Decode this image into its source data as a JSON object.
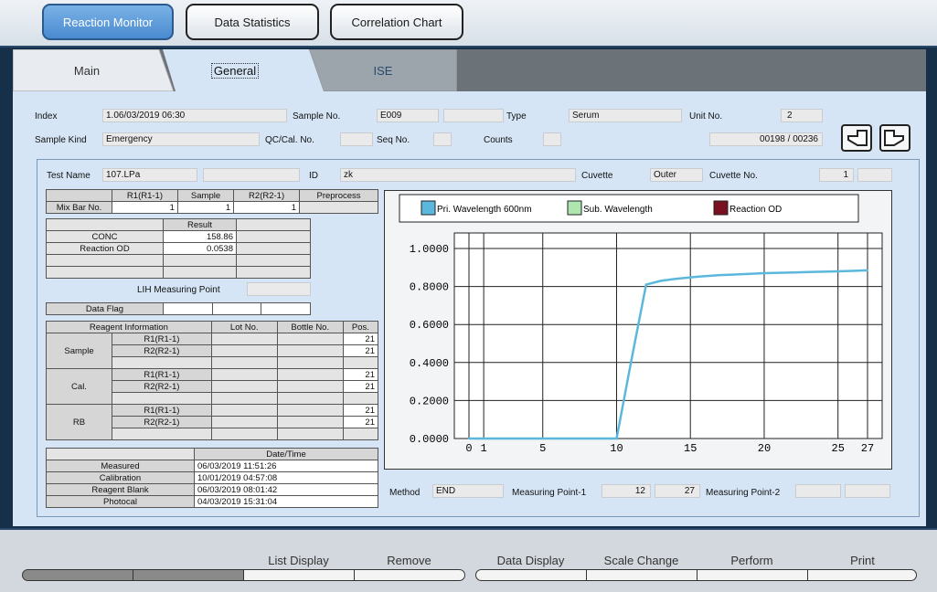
{
  "top_buttons": [
    "Reaction Monitor",
    "Data Statistics",
    "Correlation Chart"
  ],
  "tabs": [
    "Main",
    "General",
    "ISE"
  ],
  "header": {
    "index_label": "Index",
    "index_value": "1.06/03/2019 06:30",
    "sample_no_label": "Sample No.",
    "sample_no_value": "E009",
    "type_label": "Type",
    "type_value": "Serum",
    "unit_no_label": "Unit No.",
    "unit_no_value": "2",
    "sample_kind_label": "Sample Kind",
    "sample_kind_value": "Emergency",
    "qc_label": "QC/Cal. No.",
    "seq_label": "Seq No.",
    "counts_label": "Counts",
    "page_counter": "00198 / 00236"
  },
  "test": {
    "test_name_label": "Test Name",
    "test_name_value": "107.LPa",
    "id_label": "ID",
    "id_value": "zk",
    "cuvette_label": "Cuvette",
    "cuvette_value": "Outer",
    "cuvette_no_label": "Cuvette No.",
    "cuvette_no_value": "1"
  },
  "mix_table": {
    "headers": [
      "R1(R1-1)",
      "Sample",
      "R2(R2-1)",
      "Preprocess"
    ],
    "row_label": "Mix Bar No.",
    "values": [
      "1",
      "1",
      "1",
      ""
    ]
  },
  "result_table": {
    "header": "Result",
    "rows": [
      {
        "label": "CONC",
        "value": "158.86"
      },
      {
        "label": "Reaction OD",
        "value": "0.0538"
      }
    ]
  },
  "lih_label": "LIH Measuring Point",
  "data_flag_label": "Data Flag",
  "reagent_table": {
    "headers": [
      "Reagent Information",
      "Lot No.",
      "Bottle No.",
      "Pos."
    ],
    "groups": [
      {
        "name": "Sample",
        "rows": [
          {
            "reagent": "R1(R1-1)",
            "pos": "21"
          },
          {
            "reagent": "R2(R2-1)",
            "pos": "21"
          }
        ]
      },
      {
        "name": "Cal.",
        "rows": [
          {
            "reagent": "R1(R1-1)",
            "pos": "21"
          },
          {
            "reagent": "R2(R2-1)",
            "pos": "21"
          }
        ]
      },
      {
        "name": "RB",
        "rows": [
          {
            "reagent": "R1(R1-1)",
            "pos": "21"
          },
          {
            "reagent": "R2(R2-1)",
            "pos": "21"
          }
        ]
      }
    ]
  },
  "datetime_table": {
    "header": "Date/Time",
    "rows": [
      {
        "label": "Measured",
        "value": "06/03/2019 11:51:26"
      },
      {
        "label": "Calibration",
        "value": "10/01/2019 04:57:08"
      },
      {
        "label": "Reagent Blank",
        "value": "06/03/2019 08:01:42"
      },
      {
        "label": "Photocal",
        "value": "04/03/2019 15:31:04"
      }
    ]
  },
  "chart_data": {
    "type": "line",
    "x_ticks": [
      "0",
      "1",
      "5",
      "10",
      "15",
      "20",
      "25",
      "27"
    ],
    "y_ticks": [
      "0.0000",
      "0.2000",
      "0.4000",
      "0.6000",
      "0.8000",
      "1.0000"
    ],
    "xlim": [
      0,
      27
    ],
    "ylim": [
      0,
      1
    ],
    "series": [
      {
        "name": "Pri. Wavelength 600nm",
        "color": "#5bb8dc",
        "x": [
          0,
          1,
          2,
          3,
          4,
          5,
          6,
          7,
          8,
          9,
          10,
          11,
          12,
          13,
          14,
          15,
          16,
          17,
          18,
          19,
          20,
          21,
          22,
          23,
          24,
          25,
          26,
          27
        ],
        "y": [
          0.0,
          0.0,
          0.0,
          0.0,
          0.0,
          0.0,
          0.0,
          0.0,
          0.0,
          0.0,
          0.0,
          0.41,
          0.81,
          0.83,
          0.84,
          0.848,
          0.855,
          0.86,
          0.863,
          0.867,
          0.87,
          0.872,
          0.874,
          0.876,
          0.878,
          0.88,
          0.882,
          0.885
        ]
      },
      {
        "name": "Sub. Wavelength",
        "color": "#aee6b0",
        "x": [],
        "y": []
      },
      {
        "name": "Reaction OD",
        "color": "#7a1020",
        "x": [],
        "y": []
      }
    ],
    "grid": true,
    "legend": "top"
  },
  "method": {
    "label": "Method",
    "value": "END",
    "mp1_label": "Measuring Point-1",
    "mp1_start": "12",
    "mp1_end": "27",
    "mp2_label": "Measuring Point-2"
  },
  "function_keys": [
    "",
    "",
    "List Display",
    "Remove",
    "Data Display",
    "Scale Change",
    "Perform",
    "Print"
  ]
}
